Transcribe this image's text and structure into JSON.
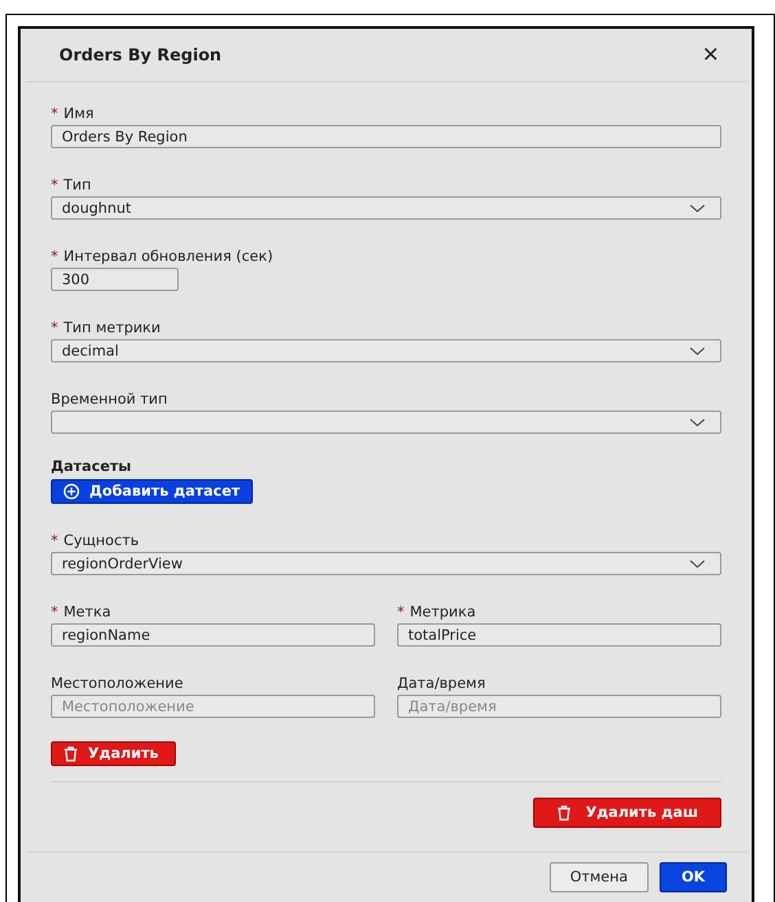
{
  "dialog": {
    "title": "Orders By Region",
    "close": "×"
  },
  "fields": [
    {
      "kind": "text",
      "mark": "*",
      "label": "Имя",
      "value": "Orders By Region"
    },
    {
      "kind": "select",
      "mark": "*",
      "label": "Тип",
      "value": "doughnut"
    },
    {
      "kind": "short",
      "mark": "*",
      "label": "Интервал обновления (сек)",
      "value": "300"
    },
    {
      "kind": "select",
      "mark": "*",
      "label": "Тип метрики",
      "value": "decimal"
    },
    {
      "kind": "select",
      "label": "Временной тип"
    }
  ],
  "datasets": {
    "heading": "Датасеты",
    "add_button": "Добавить датасет",
    "entity": {
      "mark": "*",
      "label": "Сущность",
      "value": "regionOrderView"
    },
    "pairs": [
      [
        {
          "mark": "*",
          "label": "Метка",
          "value": "regionName"
        },
        {
          "mark": "*",
          "label": "Метрика",
          "value": "totalPrice"
        }
      ],
      [
        {
          "label": "Местоположение",
          "placeholder": "Местоположение"
        },
        {
          "label": "Дата/время",
          "placeholder": "Дата/время"
        }
      ]
    ],
    "delete_button": "Удалить"
  },
  "delete_dashboard_button": "Удалить даш",
  "footer": {
    "cancel": "Отмена",
    "ok": "OK"
  }
}
